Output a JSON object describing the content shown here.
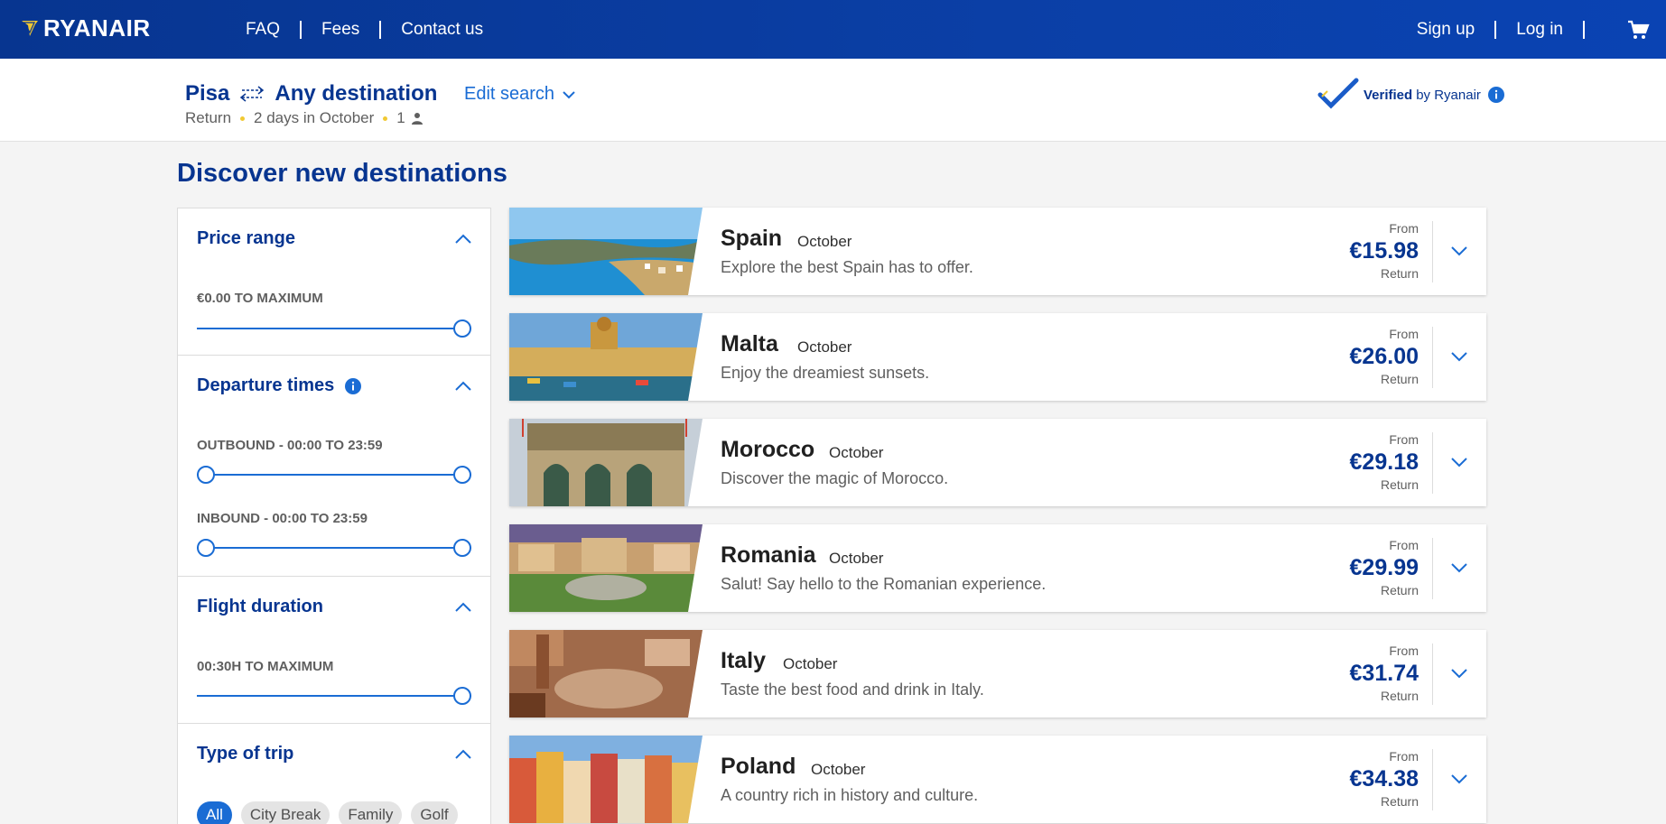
{
  "header": {
    "logo_text": "RYANAIR",
    "nav_left": [
      "FAQ",
      "Fees",
      "Contact us"
    ],
    "nav_right": [
      "Sign up",
      "Log in"
    ],
    "cart_icon": "cart-icon",
    "brand_color": "#073590"
  },
  "search": {
    "origin": "Pisa",
    "destination": "Any destination",
    "trip_type": "Return",
    "dates": "2 days in October",
    "passengers": "1",
    "edit_label": "Edit search",
    "verified_bold": "Verified",
    "verified_rest": "by Ryanair"
  },
  "page_title": "Discover new destinations",
  "filters": {
    "price": {
      "title": "Price range",
      "label": "€0.00 TO MAXIMUM",
      "max_position": 1.0
    },
    "departure": {
      "title": "Departure times",
      "outbound_label": "OUTBOUND - 00:00 TO 23:59",
      "inbound_label": "INBOUND - 00:00 TO 23:59"
    },
    "duration": {
      "title": "Flight duration",
      "label": "00:30H TO MAXIMUM"
    },
    "trip_type": {
      "title": "Type of trip",
      "chips": [
        "All",
        "City Break",
        "Family",
        "Golf"
      ],
      "active": "All"
    }
  },
  "destinations": [
    {
      "country": "Spain",
      "month": "October",
      "desc": "Explore the best Spain has to offer.",
      "from": "From",
      "price": "€15.98",
      "ret": "Return"
    },
    {
      "country": "Malta",
      "month": "October",
      "desc": "Enjoy the dreamiest sunsets.",
      "from": "From",
      "price": "€26.00",
      "ret": "Return"
    },
    {
      "country": "Morocco",
      "month": "October",
      "desc": "Discover the magic of Morocco.",
      "from": "From",
      "price": "€29.18",
      "ret": "Return"
    },
    {
      "country": "Romania",
      "month": "October",
      "desc": "Salut! Say hello to the Romanian experience.",
      "from": "From",
      "price": "€29.99",
      "ret": "Return"
    },
    {
      "country": "Italy",
      "month": "October",
      "desc": "Taste the best food and drink in Italy.",
      "from": "From",
      "price": "€31.74",
      "ret": "Return"
    },
    {
      "country": "Poland",
      "month": "October",
      "desc": "A country rich in history and culture.",
      "from": "From",
      "price": "€34.38",
      "ret": "Return"
    }
  ]
}
